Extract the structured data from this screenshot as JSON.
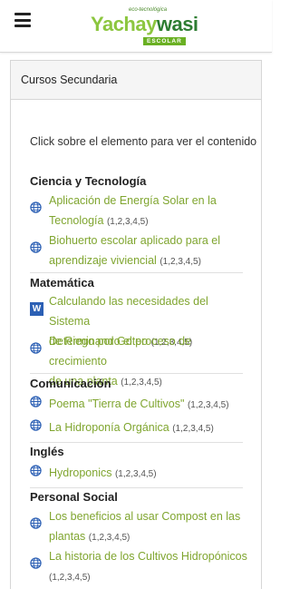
{
  "header": {
    "logo": {
      "tagline": "eco-tecnológica",
      "name_part1": "Yachay",
      "name_part2": "wasi",
      "badge": "ESCOLAR"
    }
  },
  "card": {
    "title": "Cursos Secundaria",
    "instruction": "Click sobre el elemento para ver el contenido"
  },
  "sections": [
    {
      "title": "Ciencia y Tecnología",
      "items": [
        {
          "icon": "globe-icon",
          "line1": "Aplicación de Energía Solar en la",
          "line2": "Tecnología",
          "grades": "(1,2,3,4,5)"
        },
        {
          "icon": "globe-icon",
          "line1": "Biohuerto escolar aplicado para el",
          "line2": "aprendizaje viviencial",
          "grades": "(1,2,3,4,5)"
        }
      ]
    },
    {
      "title": "Matemática",
      "items": [
        {
          "icon": "word-doc-icon",
          "icon_letter": "W",
          "line1": "Calculando las necesidades del Sistema",
          "line2": "de Riego por Goteo",
          "grades": "(1,2,3,4,5)"
        },
        {
          "icon": "globe-icon",
          "line1": "Determinando el proceso de crecimiento",
          "line2": "de una planta",
          "grades": "(1,2,3,4,5)"
        }
      ]
    },
    {
      "title": "Comunicación",
      "items": [
        {
          "icon": "globe-icon",
          "line1": "Poema \"Tierra de Cultivos\"",
          "grades": "(1,2,3,4,5)"
        },
        {
          "icon": "globe-icon",
          "line1": "La Hidroponía Orgánica",
          "grades": "(1,2,3,4,5)"
        }
      ]
    },
    {
      "title": "Inglés",
      "items": [
        {
          "icon": "globe-icon",
          "line1": "Hydroponics",
          "grades": "(1,2,3,4,5)"
        }
      ]
    },
    {
      "title": "Personal Social",
      "items": [
        {
          "icon": "globe-icon",
          "line1": "Los beneficios al usar Compost en las",
          "line2": "plantas",
          "grades": "(1,2,3,4,5)"
        },
        {
          "icon": "globe-icon",
          "line1": "La historia de los Cultivos Hidropónicos",
          "line2": "",
          "grades": "(1,2,3,4,5)"
        }
      ]
    }
  ],
  "colors": {
    "link": "#7fa52f",
    "brand_light": "#8cc63f",
    "brand_dark": "#2e7d32",
    "globe": "#2b5fb4"
  }
}
